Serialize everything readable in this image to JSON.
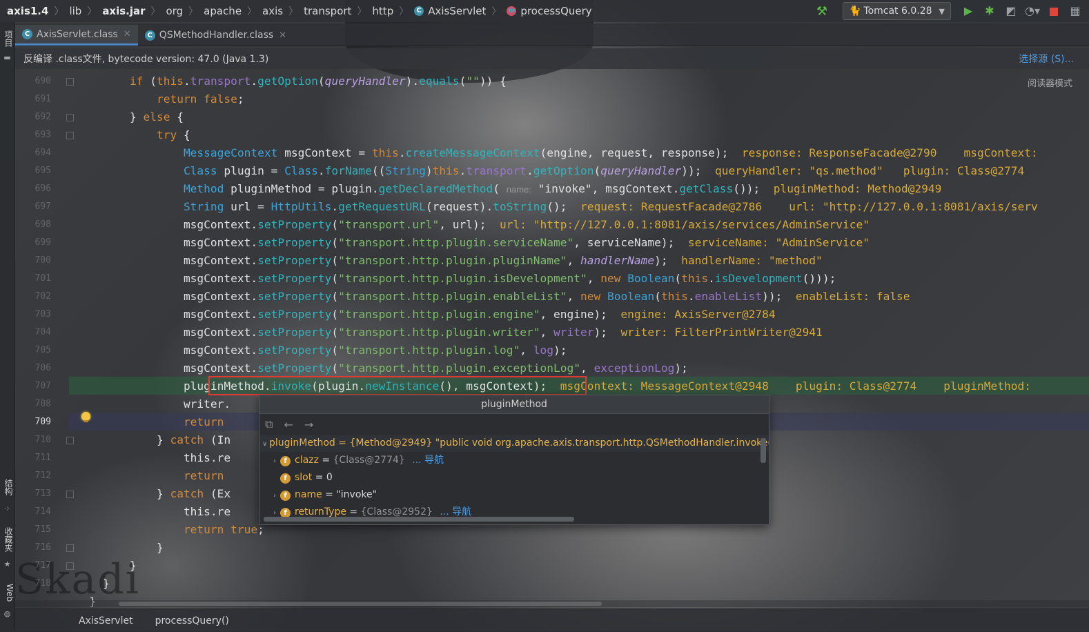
{
  "breadcrumb": [
    "axis1.4",
    "lib",
    "axis.jar",
    "org",
    "apache",
    "axis",
    "transport",
    "http",
    "AxisServlet",
    "processQuery"
  ],
  "run_config": {
    "label": "Tomcat 6.0.28"
  },
  "left_tools": {
    "project": "项目",
    "structure": "结构",
    "favorites": "收藏夹",
    "web": "Web"
  },
  "tabs": [
    {
      "label": "AxisServlet.class",
      "active": true
    },
    {
      "label": "QSMethodHandler.class",
      "active": false
    }
  ],
  "infobar": {
    "message": "反编译 .class文件, bytecode version: 47.0 (Java 1.3)",
    "action": "选择源 (S)..."
  },
  "reader_mode": "阅读器模式",
  "line_numbers": [
    "690",
    "691",
    "692",
    "693",
    "694",
    "695",
    "696",
    "697",
    "698",
    "699",
    "700",
    "701",
    "702",
    "703",
    "704",
    "705",
    "706",
    "707",
    "708",
    "709",
    "710",
    "711",
    "712",
    "713",
    "714",
    "715",
    "716",
    "717",
    "718"
  ],
  "current_line": "709",
  "hints": {
    "name_param": "name:",
    "l694": "response: ResponseFacade@2790    msgContext:",
    "l695_a": "queryHandler: \"qs.method\"",
    "l695_b": "plugin: Class@2774",
    "l696": "pluginMethod: Method@2949",
    "l697_a": "request: RequestFacade@2786",
    "l697_b": "url: \"http://127.0.0.1:8081/axis/serv",
    "l698": "url: \"http://127.0.0.1:8081/axis/services/AdminService\"",
    "l699": "serviceName: \"AdminService\"",
    "l700": "handlerName: \"method\"",
    "l702": "enableList: false",
    "l703": "engine: AxisServer@2784",
    "l704": "writer: FilterPrintWriter@2941",
    "l707_a": "msgContext: MessageContext@2948",
    "l707_b": "plugin: Class@2774",
    "l707_c": "pluginMethod:"
  },
  "popup": {
    "title": "pluginMethod",
    "root": {
      "name": "pluginMethod",
      "value": "= {Method@2949} \"public void org.apache.axis.transport.http.QSMethodHandler.invoke(org."
    },
    "fields": [
      {
        "name": "clazz",
        "eq": "=",
        "value": "{Class@2774}",
        "link": "... 导航",
        "expandable": true
      },
      {
        "name": "slot",
        "eq": "=",
        "value": "0",
        "link": "",
        "expandable": false
      },
      {
        "name": "name",
        "eq": "=",
        "value": "\"invoke\"",
        "link": "",
        "expandable": true
      },
      {
        "name": "returnType",
        "eq": "=",
        "value": "{Class@2952}",
        "link": "... 导航",
        "expandable": true
      }
    ]
  },
  "status_path": [
    "AxisServlet",
    "processQuery()"
  ],
  "watermark": "Skadi",
  "colors": {
    "keyword": "#d08a3c",
    "field": "#9876c9",
    "string": "#7dbb6a",
    "method": "#33b2bc",
    "highlight_box": "#e53935",
    "exec_line": "#2d5f3e",
    "accent": "#4a88c7"
  }
}
